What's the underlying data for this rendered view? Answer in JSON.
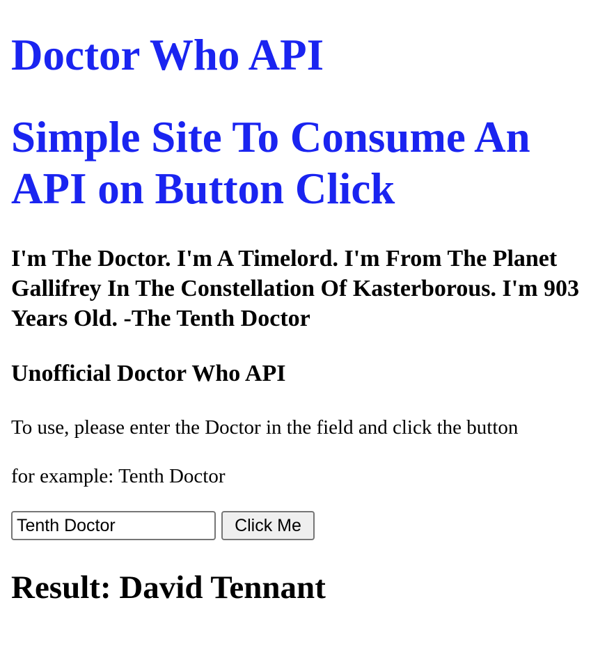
{
  "colors": {
    "heading_blue": "#1a24f0",
    "text": "#000000",
    "background": "#ffffff",
    "button_bg": "#efefef",
    "control_border": "#767676"
  },
  "header": {
    "title": "Doctor Who API",
    "subtitle": "Simple Site To Consume An API on Button Click"
  },
  "quote": "I'm The Doctor. I'm A Timelord. I'm From The Planet Gallifrey In The Constellation Of Kasterborous. I'm 903 Years Old. -The Tenth Doctor",
  "api_heading": "Unofficial Doctor Who API",
  "instructions": {
    "line1": "To use, please enter the Doctor in the field and click the button",
    "line2": "for example: Tenth Doctor"
  },
  "form": {
    "input_value": "Tenth Doctor",
    "button_label": "Click Me"
  },
  "result": "Result: David Tennant"
}
